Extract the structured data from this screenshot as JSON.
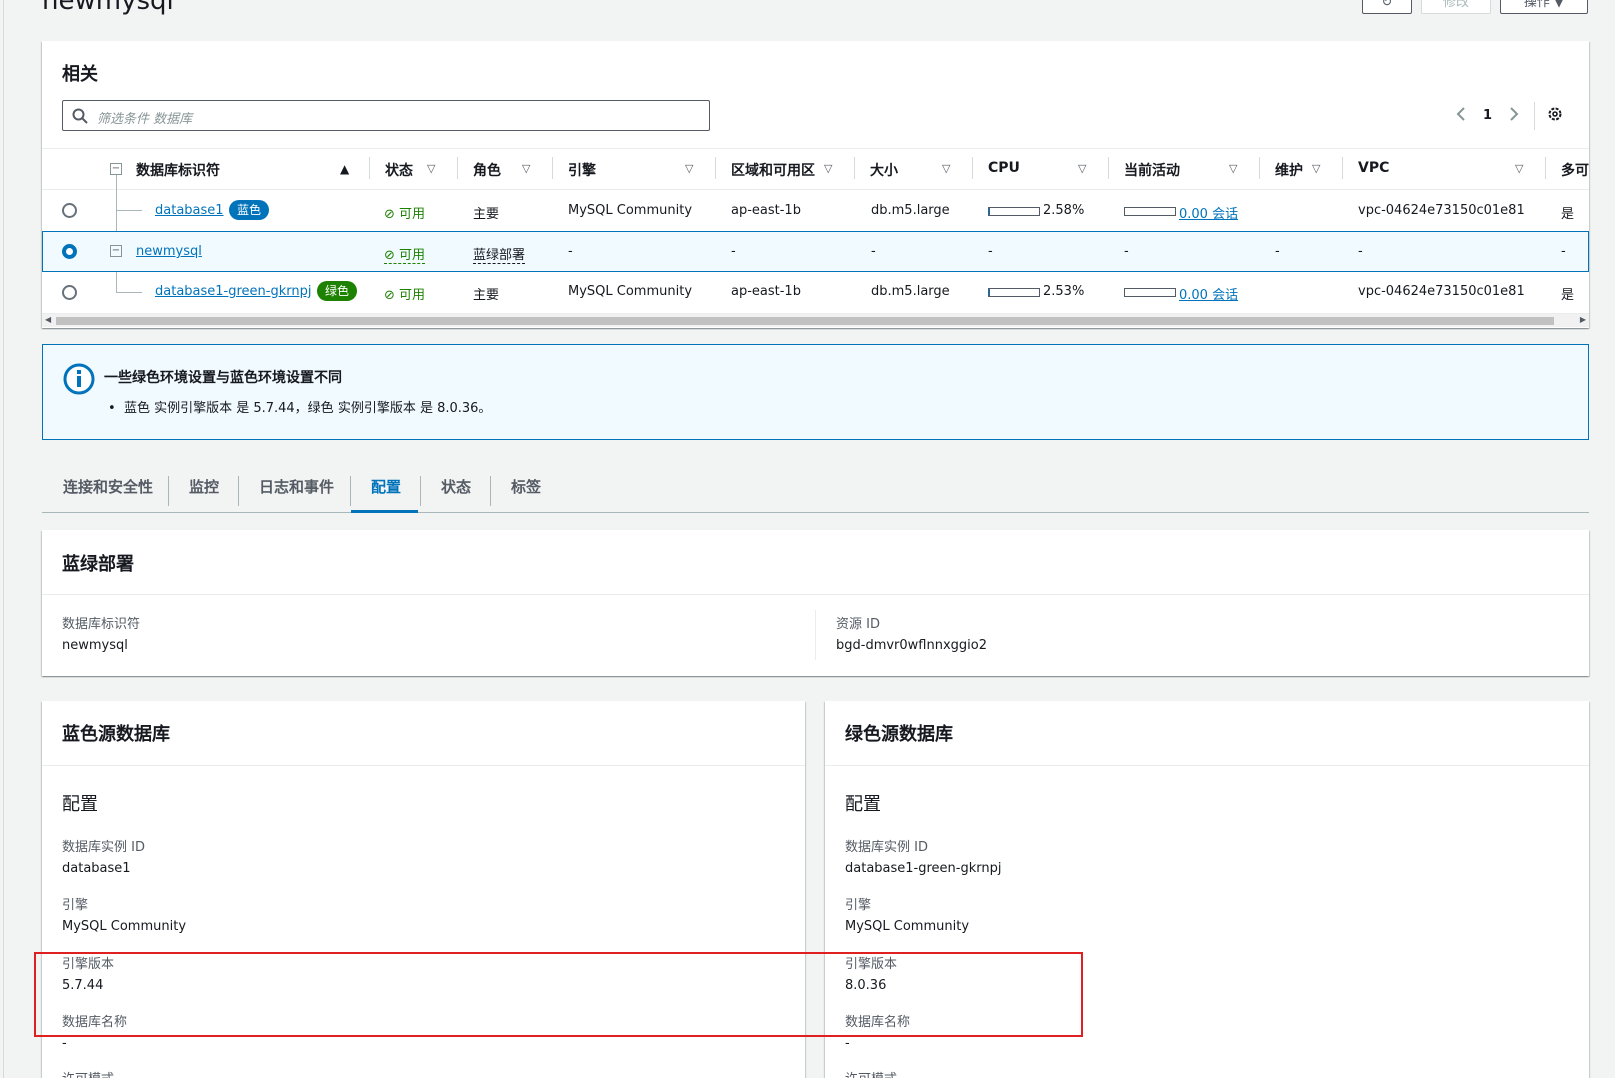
{
  "header": {
    "title": "newmysql",
    "modify_label": "修改",
    "actions_label": "操作 ▼"
  },
  "related": {
    "title": "相关",
    "search_placeholder": "筛选条件 数据库",
    "page": "1",
    "columns": [
      "数据库标识符",
      "状态",
      "角色",
      "引擎",
      "区域和可用区",
      "大小",
      "CPU",
      "当前活动",
      "维护",
      "VPC",
      "多可"
    ],
    "rows": [
      {
        "id": "database1",
        "badge": "蓝色",
        "status": "可用",
        "role": "主要",
        "engine": "MySQL Community",
        "az": "ap-east-1b",
        "size": "db.m5.large",
        "cpu": "2.58%",
        "cpu_fill": 0.0258,
        "activity": "0.00 会话",
        "maint": "",
        "vpc": "vpc-04624e73150c01e81",
        "multi": "是"
      },
      {
        "id": "newmysql",
        "badge": "",
        "status": "可用",
        "role": "蓝绿部署",
        "engine": "-",
        "az": "-",
        "size": "-",
        "cpu": "-",
        "cpu_fill": 0,
        "activity": "-",
        "maint": "-",
        "vpc": "-",
        "multi": "-"
      },
      {
        "id": "database1-green-gkrnpj",
        "badge": "绿色",
        "status": "可用",
        "role": "主要",
        "engine": "MySQL Community",
        "az": "ap-east-1b",
        "size": "db.m5.large",
        "cpu": "2.53%",
        "cpu_fill": 0.0253,
        "activity": "0.00 会话",
        "maint": "",
        "vpc": "vpc-04624e73150c01e81",
        "multi": "是"
      }
    ]
  },
  "alert": {
    "title": "一些绿色环境设置与蓝色环境设置不同",
    "item": "蓝色 实例引擎版本 是 5.7.44，绿色 实例引擎版本 是 8.0.36。"
  },
  "tabs": [
    "连接和安全性",
    "监控",
    "日志和事件",
    "配置",
    "状态",
    "标签"
  ],
  "bg": {
    "title": "蓝绿部署",
    "id_label": "数据库标识符",
    "id_value": "newmysql",
    "rid_label": "资源 ID",
    "rid_value": "bgd-dmvr0wflnnxggio2"
  },
  "blue": {
    "title": "蓝色源数据库",
    "section": "配置",
    "inst_label": "数据库实例 ID",
    "inst_value": "database1",
    "engine_label": "引擎",
    "engine_value": "MySQL Community",
    "ver_label": "引擎版本",
    "ver_value": "5.7.44",
    "dbname_label": "数据库名称",
    "dbname_value": "-",
    "license_label": "许可模式"
  },
  "green": {
    "title": "绿色源数据库",
    "section": "配置",
    "inst_label": "数据库实例 ID",
    "inst_value": "database1-green-gkrnpj",
    "engine_label": "引擎",
    "engine_value": "MySQL Community",
    "ver_label": "引擎版本",
    "ver_value": "8.0.36",
    "dbname_label": "数据库名称",
    "dbname_value": "-",
    "license_label": "许可模式"
  },
  "colors": {
    "blue_badge": "#0073bb",
    "green_badge": "#1d8102",
    "highlight": "#e02020"
  }
}
